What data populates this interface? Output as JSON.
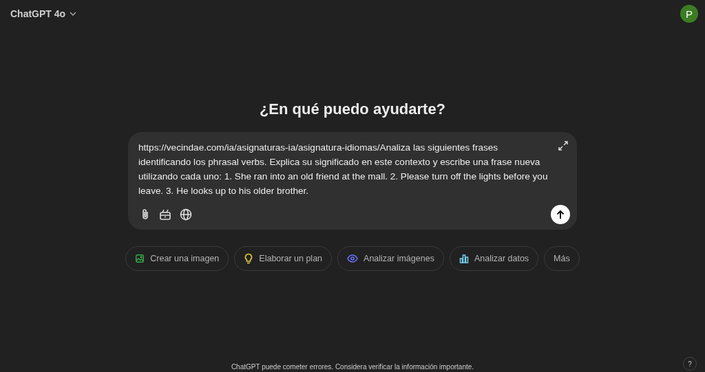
{
  "header": {
    "model": "ChatGPT 4o",
    "avatar": "P"
  },
  "heading": "¿En qué puedo ayudarte?",
  "composer": {
    "value": "https://vecindae.com/ia/asignaturas-ia/asignatura-idiomas/Analiza las siguientes frases identificando los phrasal verbs. Explica su significado en este contexto y escribe una frase nueva utilizando cada uno: 1. She ran into an old friend at the mall. 2. Please turn off the lights before you leave. 3. He looks up to his older brother."
  },
  "suggestions": [
    {
      "label": "Crear una imagen",
      "kind": "image",
      "color": "#35ae47"
    },
    {
      "label": "Elaborar un plan",
      "kind": "bulb",
      "color": "#e2c541"
    },
    {
      "label": "Analizar imágenes",
      "kind": "eye",
      "color": "#6c71ff"
    },
    {
      "label": "Analizar datos",
      "kind": "chart",
      "color": "#76d0eb"
    },
    {
      "label": "Más",
      "kind": "text"
    }
  ],
  "footer": {
    "disclaimer": "ChatGPT puede cometer errores. Considera verificar la información importante.",
    "help": "?"
  }
}
